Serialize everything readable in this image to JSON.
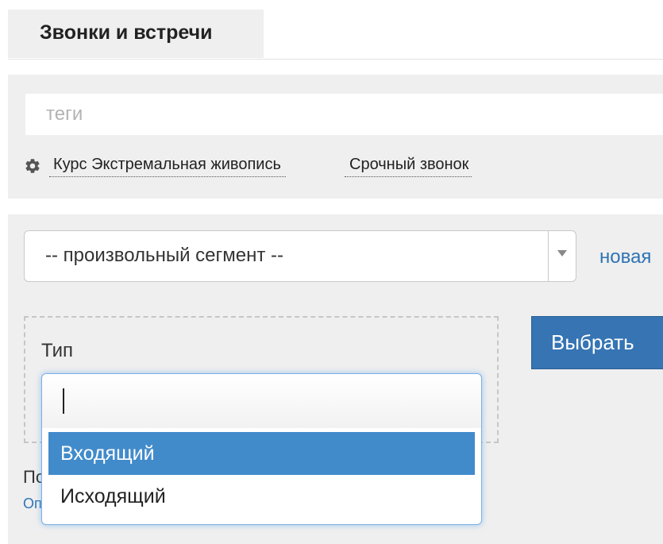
{
  "tabs": [
    {
      "label": "Звонки и встречи",
      "active": true
    }
  ],
  "tags": {
    "input_placeholder": "теги",
    "input_value": "",
    "items": [
      {
        "label": "Курс Экстремальная живопись"
      },
      {
        "label": "Срочный звонок"
      }
    ]
  },
  "segment": {
    "selected": "-- произвольный сегмент --",
    "new_link": "новая"
  },
  "filter": {
    "label": "Тип",
    "select_button": "Выбрать",
    "behind_text": "По",
    "behind_link": "Оп"
  },
  "dropdown": {
    "search_value": "",
    "options": [
      {
        "label": "Входящий",
        "highlighted": true
      },
      {
        "label": "Исходящий",
        "highlighted": false
      }
    ]
  },
  "colors": {
    "accent_link": "#2e74b5",
    "button_bg": "#3674b3",
    "highlight": "#418bcb",
    "panel_bg": "#efefef"
  },
  "icons": {
    "tag_settings": "gear-icon",
    "select_arrow": "triangle-down-icon"
  }
}
